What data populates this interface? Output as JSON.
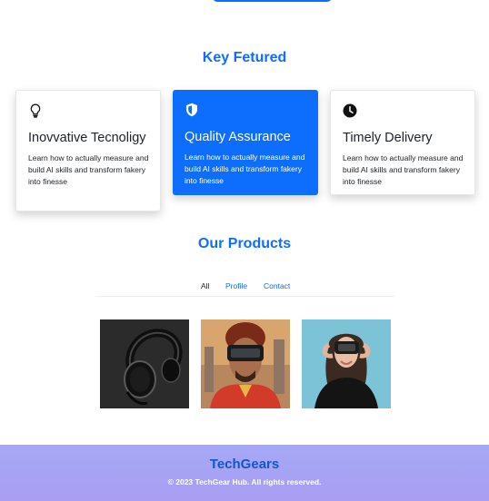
{
  "featured": {
    "title": "Key Fetured",
    "cards": [
      {
        "icon": "lightbulb-icon",
        "title": "Inovvative Tecnoligy",
        "text": "Learn how to actually measure and build AI skills and transform fakery into finesse",
        "style": "light"
      },
      {
        "icon": "shield-icon",
        "title": "Quality Assurance",
        "text": "Learn how to actually measure and build AI skills and transform fakery into finesse",
        "style": "primary"
      },
      {
        "icon": "clock-icon",
        "title": "Timely Delivery",
        "text": "Learn how to actually measure and build AI skills and transform fakery into finesse",
        "style": "light"
      }
    ]
  },
  "products": {
    "title": "Our Products",
    "tabs": [
      "All",
      "Profile",
      "Contact"
    ],
    "active_tab": "All",
    "images": [
      "headphones",
      "man-with-vr-headset",
      "woman-with-vr-headset"
    ]
  },
  "footer": {
    "brand": "TechGears",
    "copyright": "© 2023 TechGear Hub. All rights reserved."
  },
  "colors": {
    "accent": "#0d6efd",
    "footer_brand": "#1257c9"
  }
}
